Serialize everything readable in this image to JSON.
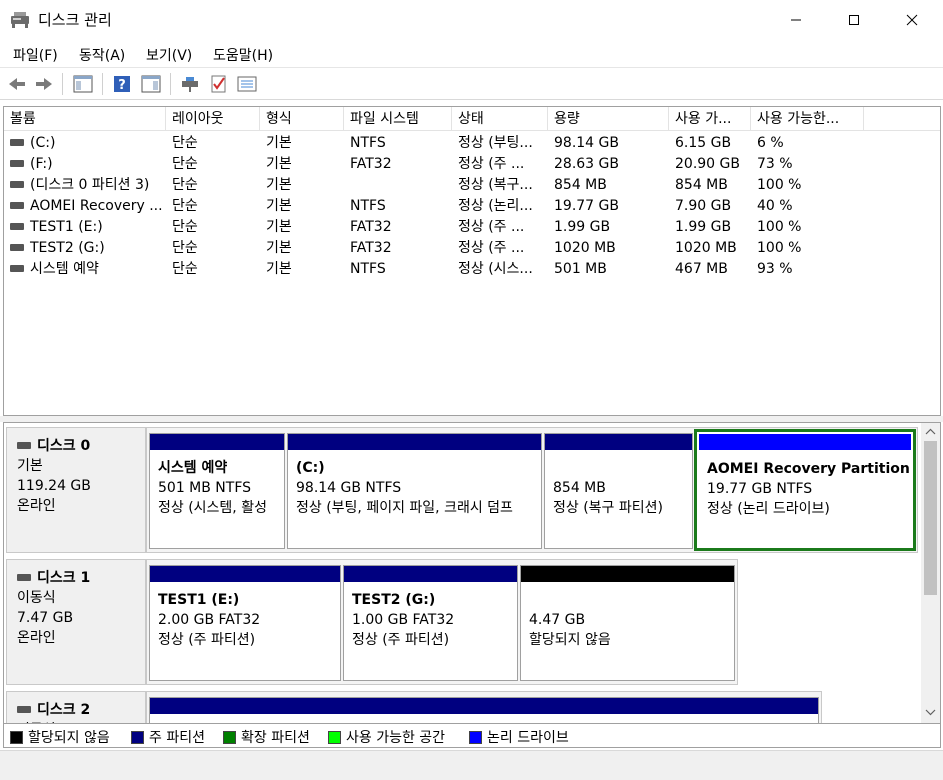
{
  "window": {
    "title": "디스크 관리",
    "icon": "disk-management-icon"
  },
  "menu": [
    "파일(F)",
    "동작(A)",
    "보기(V)",
    "도움말(H)"
  ],
  "toolbar": {
    "icons": [
      "back-arrow-icon",
      "forward-arrow-icon",
      "show-hide-console-tree-icon",
      "help-icon",
      "show-hide-action-pane-icon",
      "connect-disk-icon",
      "check-properties-icon",
      "settings-list-icon"
    ]
  },
  "volumes": {
    "columns": [
      "볼륨",
      "레이아웃",
      "형식",
      "파일 시스템",
      "상태",
      "용량",
      "사용 가...",
      "사용 가능한..."
    ],
    "rows": [
      [
        "(C:)",
        "단순",
        "기본",
        "NTFS",
        "정상 (부팅...",
        "98.14 GB",
        "6.15 GB",
        "6 %"
      ],
      [
        "(F:)",
        "단순",
        "기본",
        "FAT32",
        "정상 (주 ...",
        "28.63 GB",
        "20.90 GB",
        "73 %"
      ],
      [
        "(디스크 0 파티션 3)",
        "단순",
        "기본",
        "",
        "정상 (복구...",
        "854 MB",
        "854 MB",
        "100 %"
      ],
      [
        "AOMEI Recovery ...",
        "단순",
        "기본",
        "NTFS",
        "정상 (논리...",
        "19.77 GB",
        "7.90 GB",
        "40 %"
      ],
      [
        "TEST1 (E:)",
        "단순",
        "기본",
        "FAT32",
        "정상 (주 ...",
        "1.99 GB",
        "1.99 GB",
        "100 %"
      ],
      [
        "TEST2 (G:)",
        "단순",
        "기본",
        "FAT32",
        "정상 (주 ...",
        "1020 MB",
        "1020 MB",
        "100 %"
      ],
      [
        "시스템 예약",
        "단순",
        "기본",
        "NTFS",
        "정상 (시스...",
        "501 MB",
        "467 MB",
        "93 %"
      ]
    ]
  },
  "disks": [
    {
      "name": "디스크 0",
      "type": "기본",
      "size": "119.24 GB",
      "status": "온라인",
      "partitions": [
        {
          "name": "시스템 예약",
          "size": "501 MB NTFS",
          "status": "정상 (시스템, 활성",
          "bar_color": "#000080"
        },
        {
          "name": "(C:)",
          "size": "98.14 GB NTFS",
          "status": "정상 (부팅, 페이지 파일, 크래시 덤프",
          "bar_color": "#000080"
        },
        {
          "name": "",
          "size": "854 MB",
          "status": "정상 (복구 파티션)",
          "bar_color": "#000080"
        },
        {
          "name": "AOMEI Recovery Partition",
          "size": "19.77 GB NTFS",
          "status": "정상 (논리 드라이브)",
          "bar_color": "#0000ff"
        }
      ]
    },
    {
      "name": "디스크 1",
      "type": "이동식",
      "size": "7.47 GB",
      "status": "온라인",
      "partitions": [
        {
          "name": "TEST1  (E:)",
          "size": "2.00 GB FAT32",
          "status": "정상 (주 파티션)",
          "bar_color": "#000080"
        },
        {
          "name": "TEST2  (G:)",
          "size": "1.00 GB FAT32",
          "status": "정상 (주 파티션)",
          "bar_color": "#000080"
        },
        {
          "name": "",
          "size": "4.47 GB",
          "status": "할당되지 않음",
          "bar_color": "#000000"
        }
      ]
    },
    {
      "name": "디스크 2",
      "type": "이동식"
    }
  ],
  "legend": [
    {
      "label": "할당되지 않음",
      "color": "#000000"
    },
    {
      "label": "주 파티션",
      "color": "#000080"
    },
    {
      "label": "확장 파티션",
      "color": "#008000"
    },
    {
      "label": "사용 가능한 공간",
      "color": "#00ff00"
    },
    {
      "label": "논리 드라이브",
      "color": "#0000ff"
    }
  ]
}
